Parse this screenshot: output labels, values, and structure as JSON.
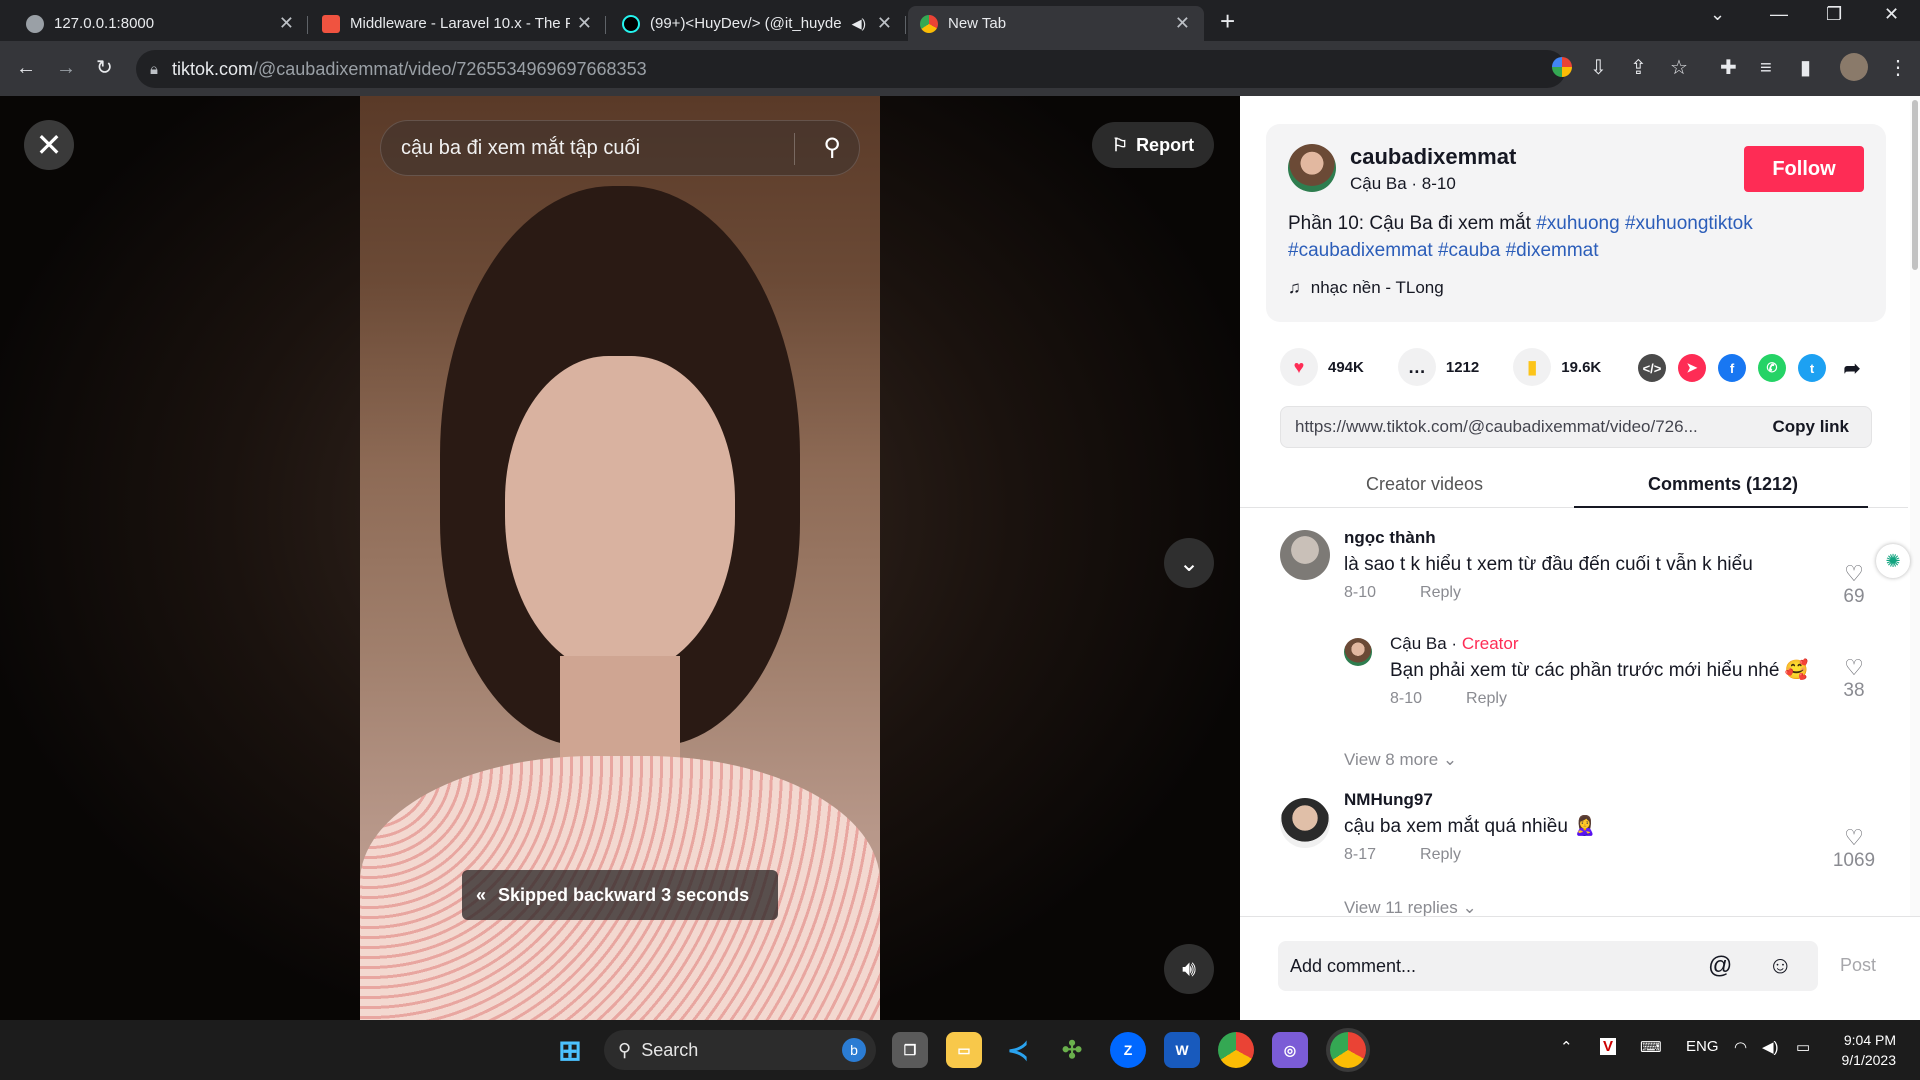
{
  "browser": {
    "tabs": [
      {
        "title": "127.0.0.1:8000",
        "favicon": "globe-icon"
      },
      {
        "title": "Middleware - Laravel 10.x - The P",
        "favicon": "laravel-icon"
      },
      {
        "title": "(99+)<HuyDev/> (@it_huyde",
        "favicon": "tiktok-icon"
      },
      {
        "title": "New Tab",
        "favicon": "chrome-icon"
      }
    ],
    "url_host": "tiktok.com",
    "url_path": "/@caubadixemmat/video/7265534969697668353"
  },
  "video": {
    "search_text": "cậu ba đi xem mắt tập cuối",
    "report_label": "Report",
    "skip_toast": "Skipped backward 3 seconds"
  },
  "post": {
    "username": "caubadixemmat",
    "subtitle": "Cậu Ba · 8-10",
    "follow_label": "Follow",
    "desc_text": "Phần 10: Cậu Ba đi xem mắt ",
    "tags": [
      "#xuhuong",
      "#xuhuongtiktok",
      "#caubadixemmat",
      "#cauba",
      "#dixemmat"
    ],
    "music": "nhạc nền - TLong",
    "likes": "494K",
    "comments_count": "1212",
    "saves": "19.6K",
    "link": "https://www.tiktok.com/@caubadixemmat/video/726...",
    "copy_label": "Copy link"
  },
  "tabs": {
    "creator_videos": "Creator videos",
    "comments": "Comments (1212)"
  },
  "comments": [
    {
      "name": "ngọc thành",
      "text": "là sao t k hiểu t xem từ đầu đến cuối t vẫn k hiểu",
      "date": "8-10",
      "reply": "Reply",
      "likes": "69"
    },
    {
      "name": "Cậu Ba",
      "creator": "Creator",
      "text": "Bạn phải xem từ các phần trước mới hiểu nhé 🥰",
      "date": "8-10",
      "reply": "Reply",
      "likes": "38"
    },
    {
      "name": "NMHung97",
      "text": "cậu ba xem mắt quá nhiều 🙎‍♀️",
      "date": "8-17",
      "reply": "Reply",
      "likes": "1069"
    }
  ],
  "view_more_1": "View 8 more",
  "view_more_2": "View 11 replies",
  "add_comment": {
    "placeholder": "Add comment...",
    "post_label": "Post"
  },
  "taskbar": {
    "search": "Search",
    "lang": "ENG",
    "time": "9:04 PM",
    "date": "9/1/2023"
  }
}
